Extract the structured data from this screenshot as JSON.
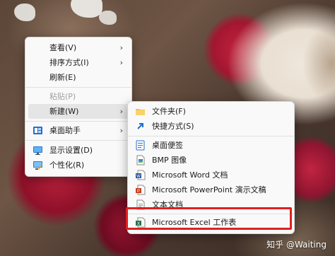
{
  "context_menu": {
    "items": [
      {
        "label": "查看(V)",
        "has_submenu": true,
        "enabled": true
      },
      {
        "label": "排序方式(I)",
        "has_submenu": true,
        "enabled": true
      },
      {
        "label": "刷新(E)",
        "has_submenu": false,
        "enabled": true
      },
      {
        "label": "粘贴(P)",
        "has_submenu": false,
        "enabled": false
      },
      {
        "label": "新建(W)",
        "has_submenu": true,
        "enabled": true,
        "active": true
      },
      {
        "label": "桌面助手",
        "has_submenu": true,
        "enabled": true,
        "icon": "desktop-assistant-icon"
      },
      {
        "label": "显示设置(D)",
        "has_submenu": false,
        "enabled": true,
        "icon": "display-settings-icon"
      },
      {
        "label": "个性化(R)",
        "has_submenu": false,
        "enabled": true,
        "icon": "personalize-icon"
      }
    ]
  },
  "submenu_new": {
    "items": [
      {
        "label": "文件夹(F)",
        "icon": "folder-icon"
      },
      {
        "label": "快捷方式(S)",
        "icon": "shortcut-icon"
      },
      {
        "label": "桌面便签",
        "icon": "sticky-note-icon"
      },
      {
        "label": "BMP 图像",
        "icon": "bmp-image-icon"
      },
      {
        "label": "Microsoft Word 文档",
        "icon": "word-icon"
      },
      {
        "label": "Microsoft PowerPoint 演示文稿",
        "icon": "powerpoint-icon"
      },
      {
        "label": "文本文档",
        "icon": "text-document-icon"
      },
      {
        "label": "Microsoft Excel 工作表",
        "icon": "excel-icon",
        "highlighted": true
      }
    ]
  },
  "watermark": "知乎 @Waiting",
  "colors": {
    "highlight_border": "#e02020",
    "menu_bg": "#f9f9f9"
  }
}
